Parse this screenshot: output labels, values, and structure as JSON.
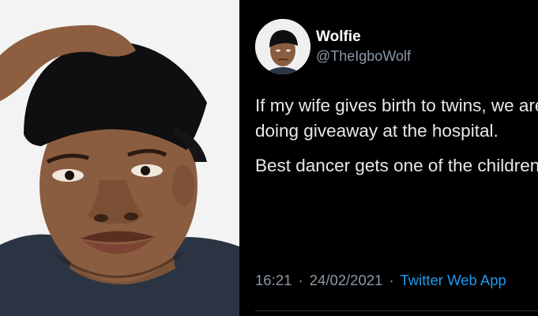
{
  "tweet": {
    "display_name": "Wolfie",
    "handle": "@TheIgboWolf",
    "paragraphs": [
      "If my wife gives birth to twins, we are doing giveaway at the hospital.",
      "Best dancer gets one of the children."
    ],
    "time": "16:21",
    "date": "24/02/2021",
    "separator": "·",
    "source_app": "Twitter Web App"
  },
  "colors": {
    "tweet_background": "#000000",
    "link_blue": "#1d9bf0",
    "muted_gray": "#8b98a5"
  }
}
